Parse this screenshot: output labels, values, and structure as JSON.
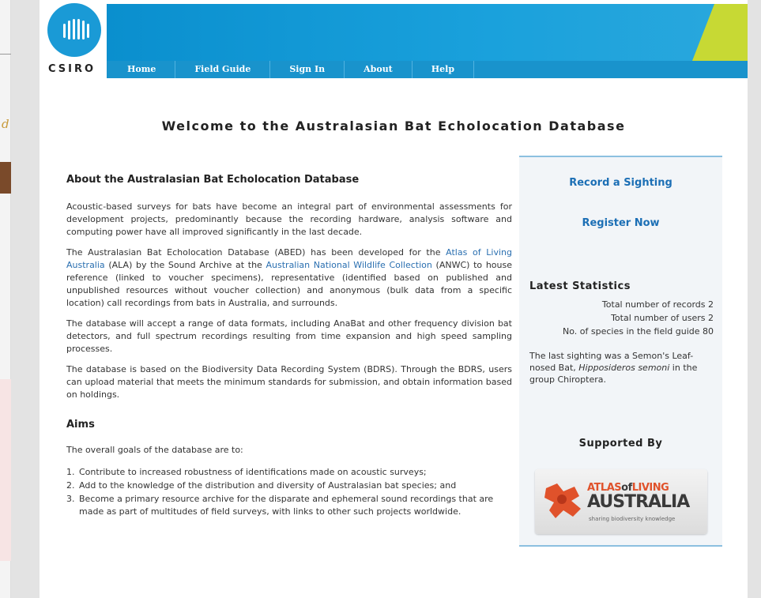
{
  "left_strip": {
    "letter": "d"
  },
  "header": {
    "logo_text": "CSIRO",
    "nav": [
      "Home",
      "Field Guide",
      "Sign In",
      "About",
      "Help"
    ]
  },
  "page_title": "Welcome to the Australasian Bat Echolocation Database",
  "main": {
    "heading": "About the Australasian Bat Echolocation Database",
    "p1": "Acoustic-based surveys for bats have become an integral part of environmental assessments for development projects, predominantly because the recording hardware, analysis software and computing power have all improved significantly in the last decade.",
    "p2_part1": "The Australasian Bat Echolocation Database (ABED) has been developed for the ",
    "p2_link1": "Atlas of Living Australia",
    "p2_part2": " (ALA) by the Sound Archive at the ",
    "p2_link2": "Australian National Wildlife Collection",
    "p2_part3": " (ANWC) to house reference (linked to voucher specimens), representative (identified based on published and unpublished resources without voucher collection) and anonymous (bulk data from a specific location) call recordings from bats in Australia, and surrounds.",
    "p3": "The database will accept a range of data formats, including AnaBat and other frequency division bat detectors, and full spectrum recordings resulting from time expansion and high speed sampling processes.",
    "p4": "The database is based on the Biodiversity Data Recording System (BDRS). Through the BDRS, users can upload material that meets the minimum standards for submission, and obtain information based on holdings.",
    "aims_heading": "Aims",
    "aims_intro": "The overall goals of the database are to:",
    "aims": [
      {
        "num": "1.",
        "text": "Contribute to increased robustness of identifications made on acoustic surveys;"
      },
      {
        "num": "2.",
        "text": "Add to the knowledge of the distribution and diversity of Australasian bat species; and"
      },
      {
        "num": "3.",
        "text": "Become a primary resource archive for the disparate and ephemeral sound recordings that are made as part of multitudes of field surveys, with links to other such projects worldwide."
      }
    ]
  },
  "sidebar": {
    "record_link": "Record a Sighting",
    "register_link": "Register Now",
    "stats_title": "Latest Statistics",
    "stats": [
      "Total number of records 2",
      "Total number of users 2",
      "No. of species in the field guide 80"
    ],
    "last_sighting_pre": "The last sighting was a Semon's Leaf-nosed Bat, ",
    "last_sighting_species": "Hipposideros semoni",
    "last_sighting_post": " in the group Chiroptera.",
    "supported_by": "Supported By",
    "ala_logo": {
      "top_a": "ATLAS",
      "top_b": "of",
      "top_c": "LIVING",
      "main": "AUSTRALIA",
      "tagline": "sharing biodiversity knowledge"
    }
  },
  "colors": {
    "brand_blue": "#1a9ad6",
    "nav_blue": "#1993cc",
    "accent_green": "#c7d934",
    "link_blue": "#1c6fb5",
    "ala_orange": "#e0522b"
  }
}
